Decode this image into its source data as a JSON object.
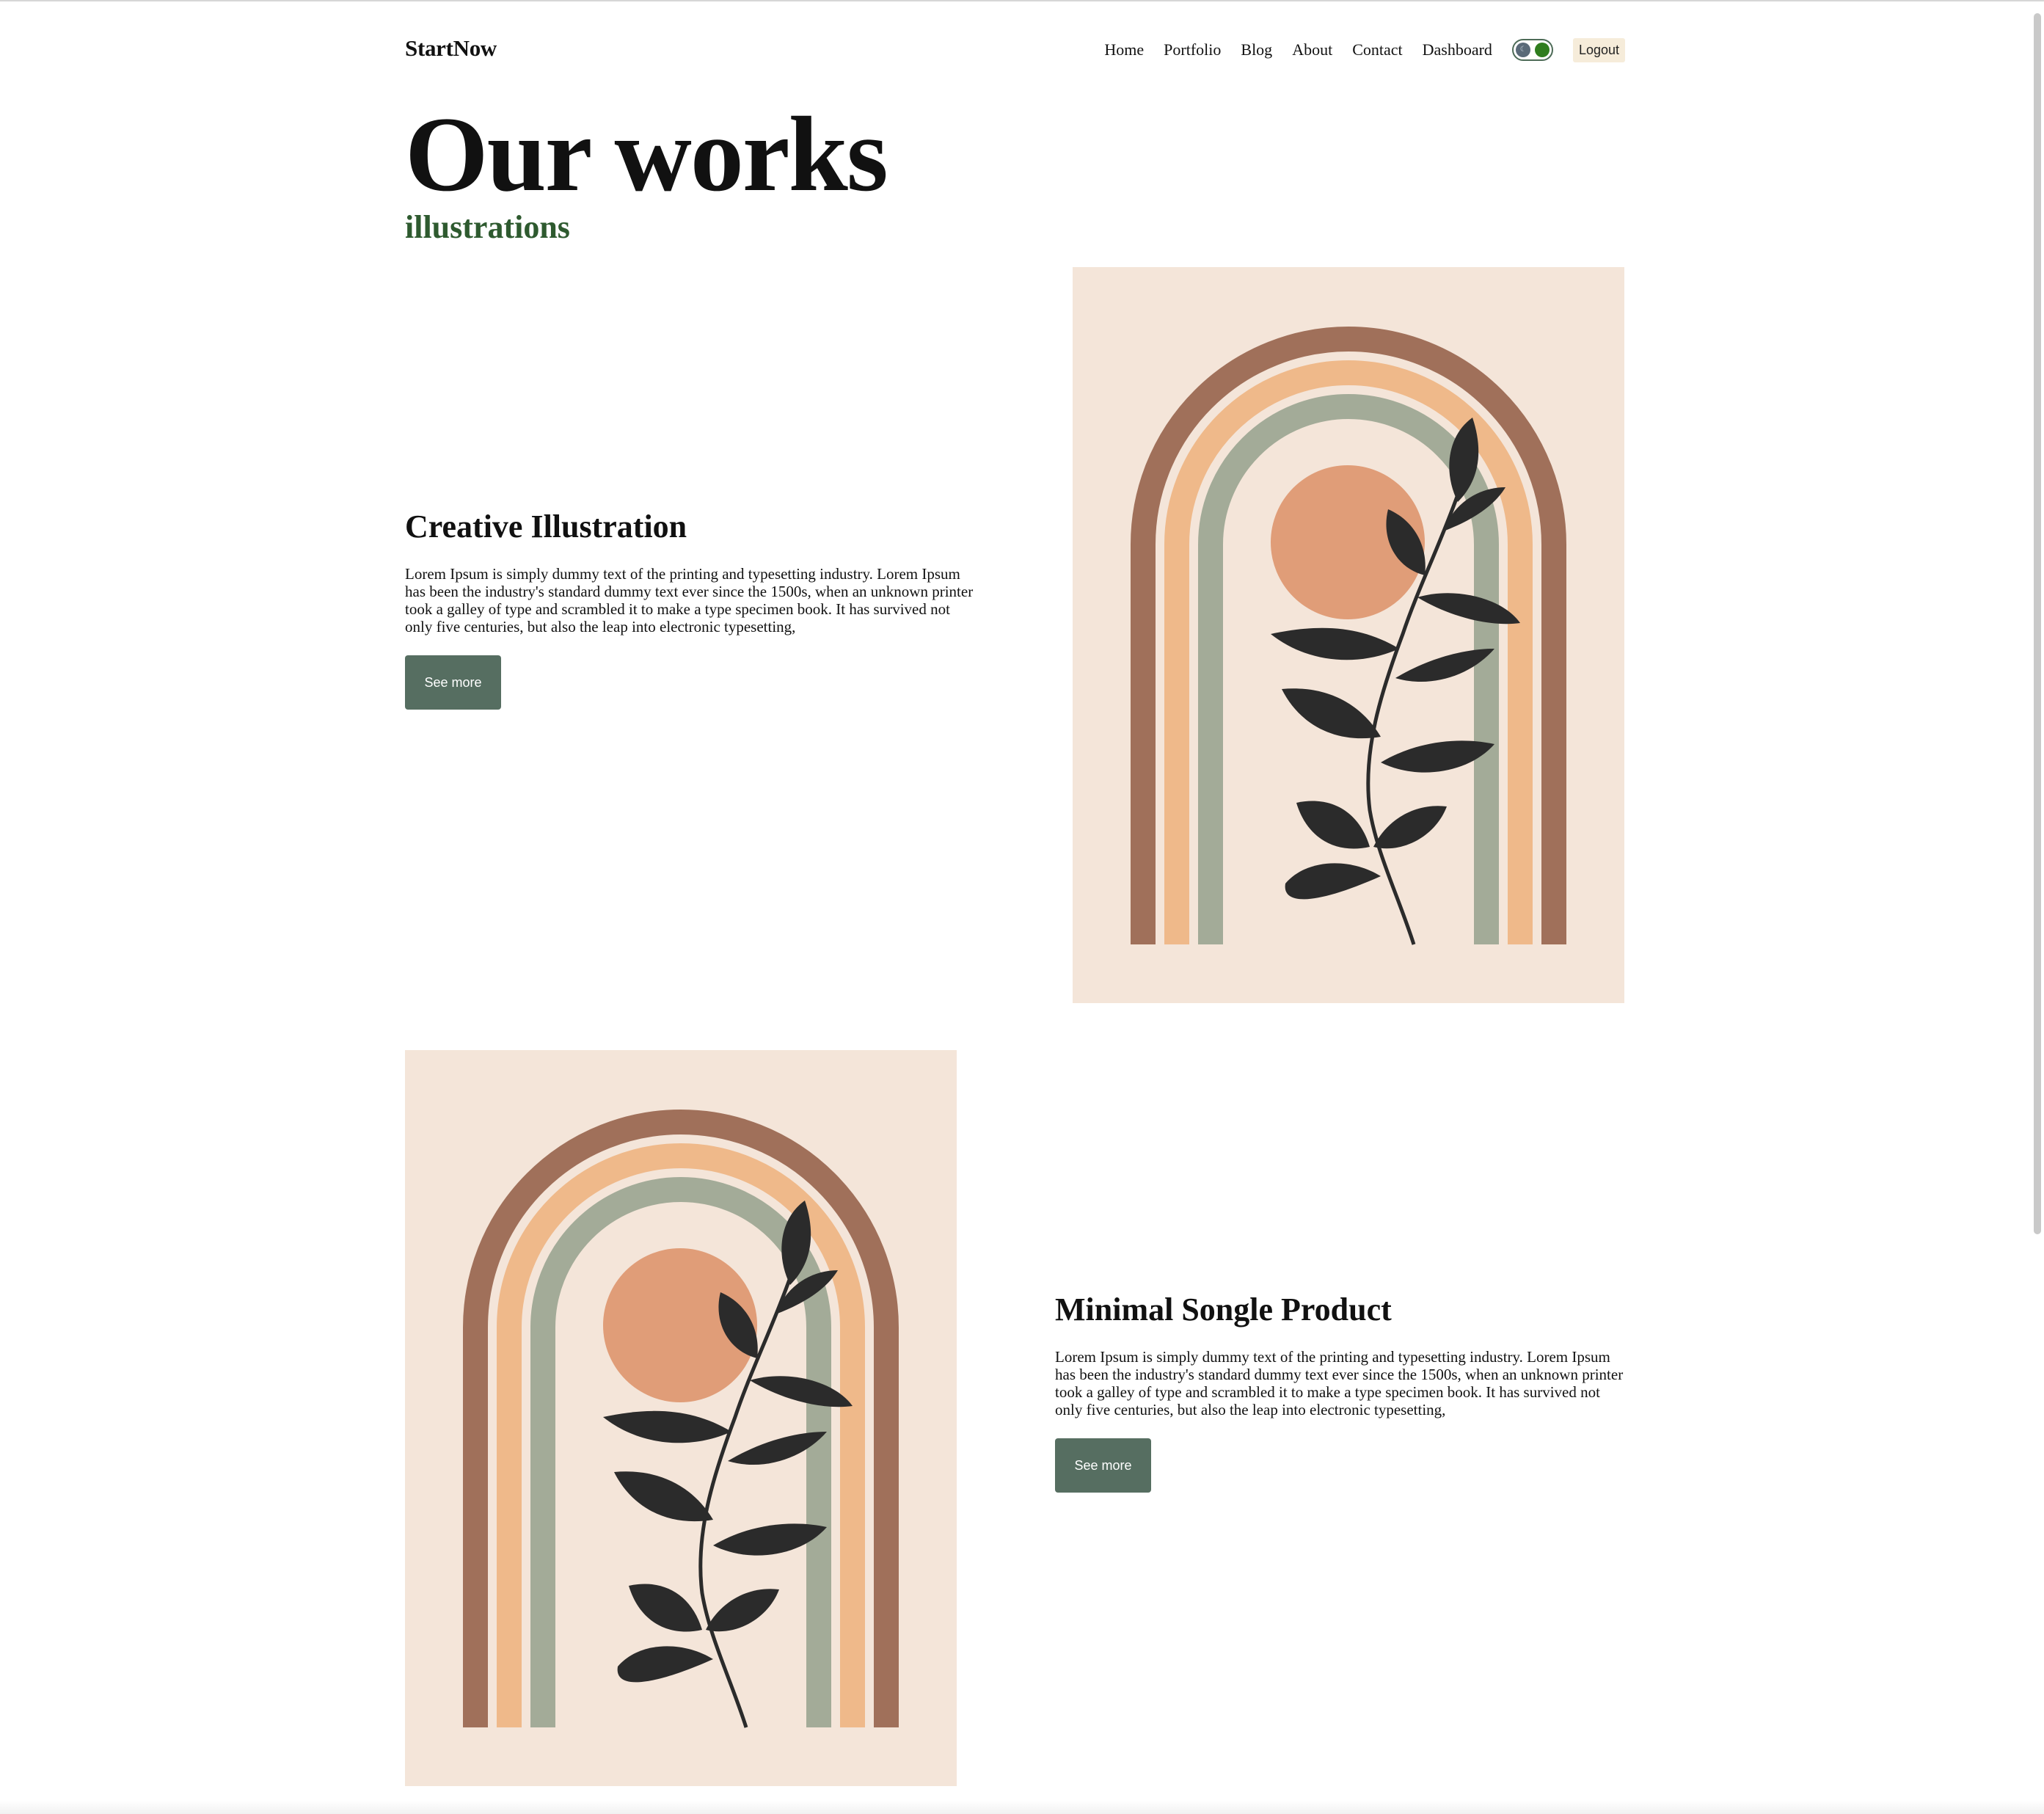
{
  "navbar": {
    "logo": "StartNow",
    "links": [
      "Home",
      "Portfolio",
      "Blog",
      "About",
      "Contact",
      "Dashboard"
    ],
    "theme_toggle_icon": "moon-icon",
    "logout_label": "Logout"
  },
  "hero": {
    "title": "Our works",
    "subtitle": "illustrations"
  },
  "works": [
    {
      "title": "Creative Illustration",
      "description": "Lorem Ipsum is simply dummy text of the printing and typesetting industry. Lorem Ipsum has been the industry's standard dummy text ever since the 1500s, when an unknown printer took a galley of type and scrambled it to make a type specimen book. It has survived not only five centuries, but also the leap into electronic typesetting,",
      "button_label": "See more"
    },
    {
      "title": "Minimal Songle Product",
      "description": "Lorem Ipsum is simply dummy text of the printing and typesetting industry. Lorem Ipsum has been the industry's standard dummy text ever since the 1500s, when an unknown printer took a galley of type and scrambled it to make a type specimen book. It has survived not only five centuries, but also the leap into electronic typesetting,",
      "button_label": "See more"
    }
  ],
  "colors": {
    "accent_green": "#2e5a2f",
    "button_bg": "#566e61",
    "logout_bg": "#f6ecda",
    "art_background": "#f4e5d9",
    "arch_outer": "#a0705a",
    "arch_middle": "#efb98a",
    "arch_inner": "#a3ab98",
    "sun": "#e09d78",
    "leaves": "#2b2b2b"
  }
}
